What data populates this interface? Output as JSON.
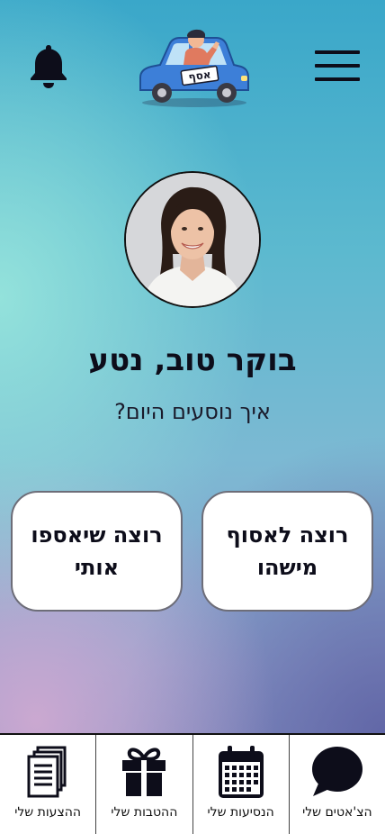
{
  "header": {
    "menu_icon": "hamburger-menu-icon",
    "notification_icon": "bell-icon",
    "logo_text": "אסף"
  },
  "profile": {
    "greeting": "בוקר טוב, נטע",
    "subtitle": "איך נוסעים היום?"
  },
  "actions": {
    "pick_someone": "רוצה לאסוף מישהו",
    "get_picked": "רוצה שיאספו אותי"
  },
  "bottom_nav": {
    "items": [
      {
        "label": "ההצעות שלי",
        "icon": "documents-icon"
      },
      {
        "label": "ההטבות שלי",
        "icon": "gift-icon"
      },
      {
        "label": "הנסיעות שלי",
        "icon": "calendar-icon"
      },
      {
        "label": "הצ'אטים שלי",
        "icon": "chat-bubble-icon"
      }
    ]
  },
  "colors": {
    "text_dark": "#0d0d1a",
    "car_blue": "#3d7fd8",
    "button_bg": "#ffffff"
  }
}
